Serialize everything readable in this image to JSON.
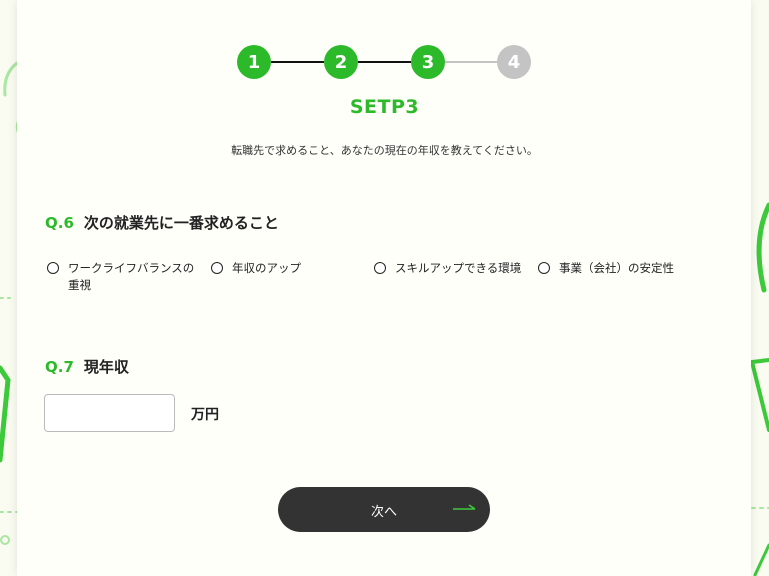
{
  "colors": {
    "accent": "#2dba2a",
    "inactive": "#c4c4c4",
    "line_done": "#111111",
    "button": "#333333"
  },
  "stepper": {
    "steps": [
      {
        "label": "1",
        "state": "done"
      },
      {
        "label": "2",
        "state": "done"
      },
      {
        "label": "3",
        "state": "current"
      },
      {
        "label": "4",
        "state": "upcoming"
      }
    ],
    "title": "SETP3",
    "description": "転職先で求めること、あなたの現在の年収を教えてください。"
  },
  "q6": {
    "number": "Q.6",
    "text": "次の就業先に一番求めること",
    "options": [
      {
        "label_line1": "ワークライフバランスの",
        "label_line2": "重視"
      },
      {
        "label_line1": "年収のアップ",
        "label_line2": ""
      },
      {
        "label_line1": "スキルアップできる環境",
        "label_line2": ""
      },
      {
        "label_line1": "事業（会社）の安定性",
        "label_line2": ""
      }
    ]
  },
  "q7": {
    "number": "Q.7",
    "text": "現年収",
    "input_value": "",
    "unit": "万円"
  },
  "next_button": {
    "label": "次へ",
    "icon": "arrow-right-icon"
  }
}
